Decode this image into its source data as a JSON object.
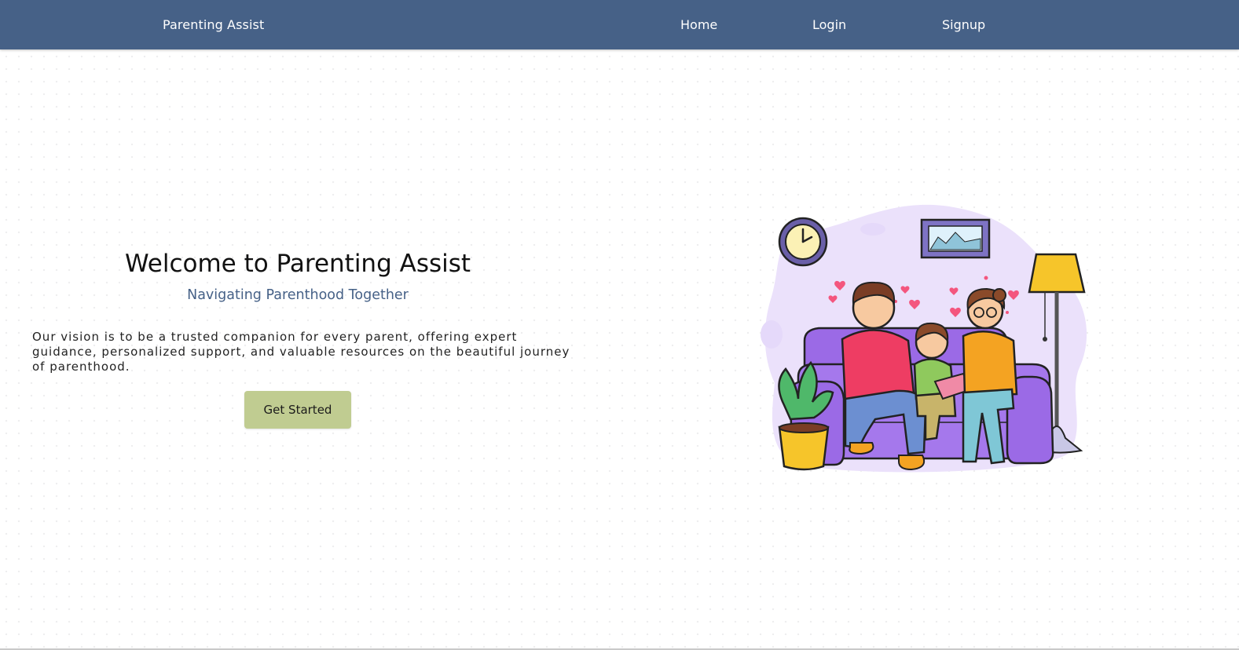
{
  "navbar": {
    "brand": "Parenting Assist",
    "links": [
      {
        "label": "Home"
      },
      {
        "label": "Login"
      },
      {
        "label": "Signup"
      }
    ],
    "background_color": "#466187"
  },
  "hero": {
    "title": "Welcome to Parenting Assist",
    "subtitle": "Navigating Parenthood Together",
    "description": "Our vision is to be a trusted companion for every parent, offering expert guidance, personalized support, and valuable resources on the beautiful journey of parenthood.",
    "cta_label": "Get Started",
    "cta_color": "#c0cc91",
    "subtitle_color": "#466187"
  },
  "illustration": {
    "icons": [
      "family-illustration",
      "wall-clock-icon",
      "picture-frame-icon",
      "floor-lamp-icon",
      "potted-plant-icon",
      "sofa-icon",
      "heart-icon"
    ],
    "colors": {
      "blob": "#ebe1fb",
      "sofa": "#9b6ae6",
      "lamp": "#f6c52a",
      "dad_shirt": "#ee3d63",
      "mom_shirt": "#f4a322",
      "child_shirt": "#8fc95d",
      "hearts": "#f4567e"
    }
  }
}
